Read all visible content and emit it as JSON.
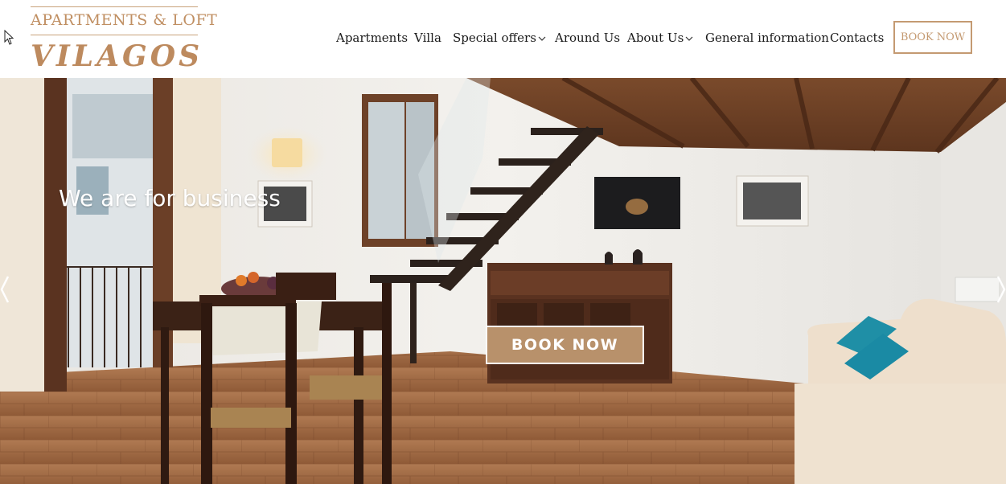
{
  "brand": {
    "subtitle": "APARTMENTS & LOFT",
    "name": "VILAGOS"
  },
  "nav": {
    "items": [
      {
        "label": "Apartments",
        "has_dropdown": false
      },
      {
        "label": "Villa",
        "has_dropdown": false
      },
      {
        "label": "Special offers",
        "has_dropdown": true
      },
      {
        "label": "Around Us",
        "has_dropdown": false
      },
      {
        "label": "About Us",
        "has_dropdown": true
      },
      {
        "label": "General information",
        "has_dropdown": false
      },
      {
        "label": "Contacts",
        "has_dropdown": false
      }
    ],
    "cta_label": "BOOK NOW"
  },
  "hero": {
    "tagline": "We are for business",
    "cta_label": "BOOK NOW",
    "prev_icon": "chevron-left-icon",
    "next_icon": "chevron-right-icon"
  },
  "colors": {
    "accent": "#c49a72",
    "accent_dark": "#b8916b",
    "text": "#1a1a1a",
    "white": "#ffffff"
  }
}
